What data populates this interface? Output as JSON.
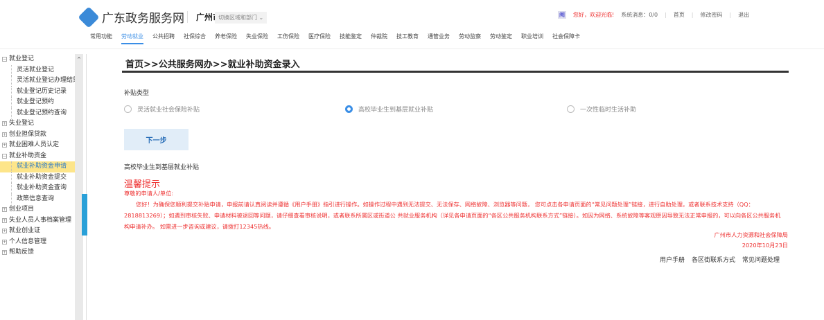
{
  "header": {
    "site_name": "广东政务服务网",
    "city": "广州市",
    "switch_label": "切换区域和部门 ⌄",
    "user_icon_text": "阉",
    "greeting": "您好，欢迎光临!",
    "messages": "系统消息：0/0",
    "links": [
      "首页",
      "修改密码",
      "退出"
    ]
  },
  "nav": {
    "items": [
      "常用功能",
      "劳动就业",
      "公共招聘",
      "社保综合",
      "养老保险",
      "失业保险",
      "工伤保险",
      "医疗保险",
      "技能鉴定",
      "仲裁院",
      "技工教育",
      "通管业务",
      "劳动监察",
      "劳动鉴定",
      "职业培训",
      "社会保障卡"
    ],
    "active": "劳动就业"
  },
  "sidebar": {
    "items": [
      {
        "label": "就业登记",
        "type": "group",
        "expanded": true
      },
      {
        "label": "灵活就业登记",
        "type": "child"
      },
      {
        "label": "灵活就业登记办理结果",
        "type": "child"
      },
      {
        "label": "就业登记历史记录",
        "type": "child"
      },
      {
        "label": "就业登记预约",
        "type": "child"
      },
      {
        "label": "就业登记预约查询",
        "type": "child"
      },
      {
        "label": "失业登记",
        "type": "group"
      },
      {
        "label": "创业担保贷款",
        "type": "group"
      },
      {
        "label": "就业困难人员认定",
        "type": "group"
      },
      {
        "label": "就业补助资金",
        "type": "group",
        "expanded": true
      },
      {
        "label": "就业补助资金申请",
        "type": "child",
        "selected": true
      },
      {
        "label": "就业补助资金提交",
        "type": "child"
      },
      {
        "label": "就业补助资金查询",
        "type": "child"
      },
      {
        "label": "政策信息查询",
        "type": "child"
      },
      {
        "label": "创业项目",
        "type": "group"
      },
      {
        "label": "失业人员人事档案管理",
        "type": "group"
      },
      {
        "label": "就业创业证",
        "type": "group"
      },
      {
        "label": "个人信息管理",
        "type": "group"
      },
      {
        "label": "帮助反馈",
        "type": "group"
      }
    ]
  },
  "main": {
    "breadcrumb": "首页>>公共服务网办>>就业补助资金录入",
    "subsidy_type_label": "补贴类型",
    "options": [
      "灵活就业社会保险补贴",
      "高校毕业生到基层就业补贴",
      "一次性临时生活补助"
    ],
    "selected_option": "高校毕业生到基层就业补贴",
    "next_button": "下一步",
    "selected_caption": "高校毕业生到基层就业补贴",
    "notice_title": "温馨提示",
    "salutation": "尊敬的申请人/单位:",
    "notice_body": "您好！为确保您顺利提交补贴申请，申报前请认真阅读并遵循《用户手册》指引进行操作。如操作过程中遇到无法提交、无法保存、网络故障、浏览器等问题， 您可点击各申请页面的“常见问题处理”链接，进行自助处理，或者联系技术支持（QQ：2818813269）；如遇到审核失败、申请材料被退回等问题，请仔细查看审核说明，或者联系所属区或街道公 共就业服务机构（详见各申请页面的“各区公共服务机构联系方式”链接）。如因为网络、系统故障等客观原因导致无法正常申报的，可以向各区公共服务机构申请补办。 如需进一步咨询或建议，请拨打12345热线。",
    "signature": "广州市人力资源和社会保障局",
    "date": "2020年10月23日",
    "footer_links": [
      "用户手册",
      "各区街联系方式",
      "常见问题处理"
    ]
  },
  "colors": {
    "accent": "#3a8ee6",
    "warning": "#e33333",
    "selected_bg": "#fde58a"
  }
}
